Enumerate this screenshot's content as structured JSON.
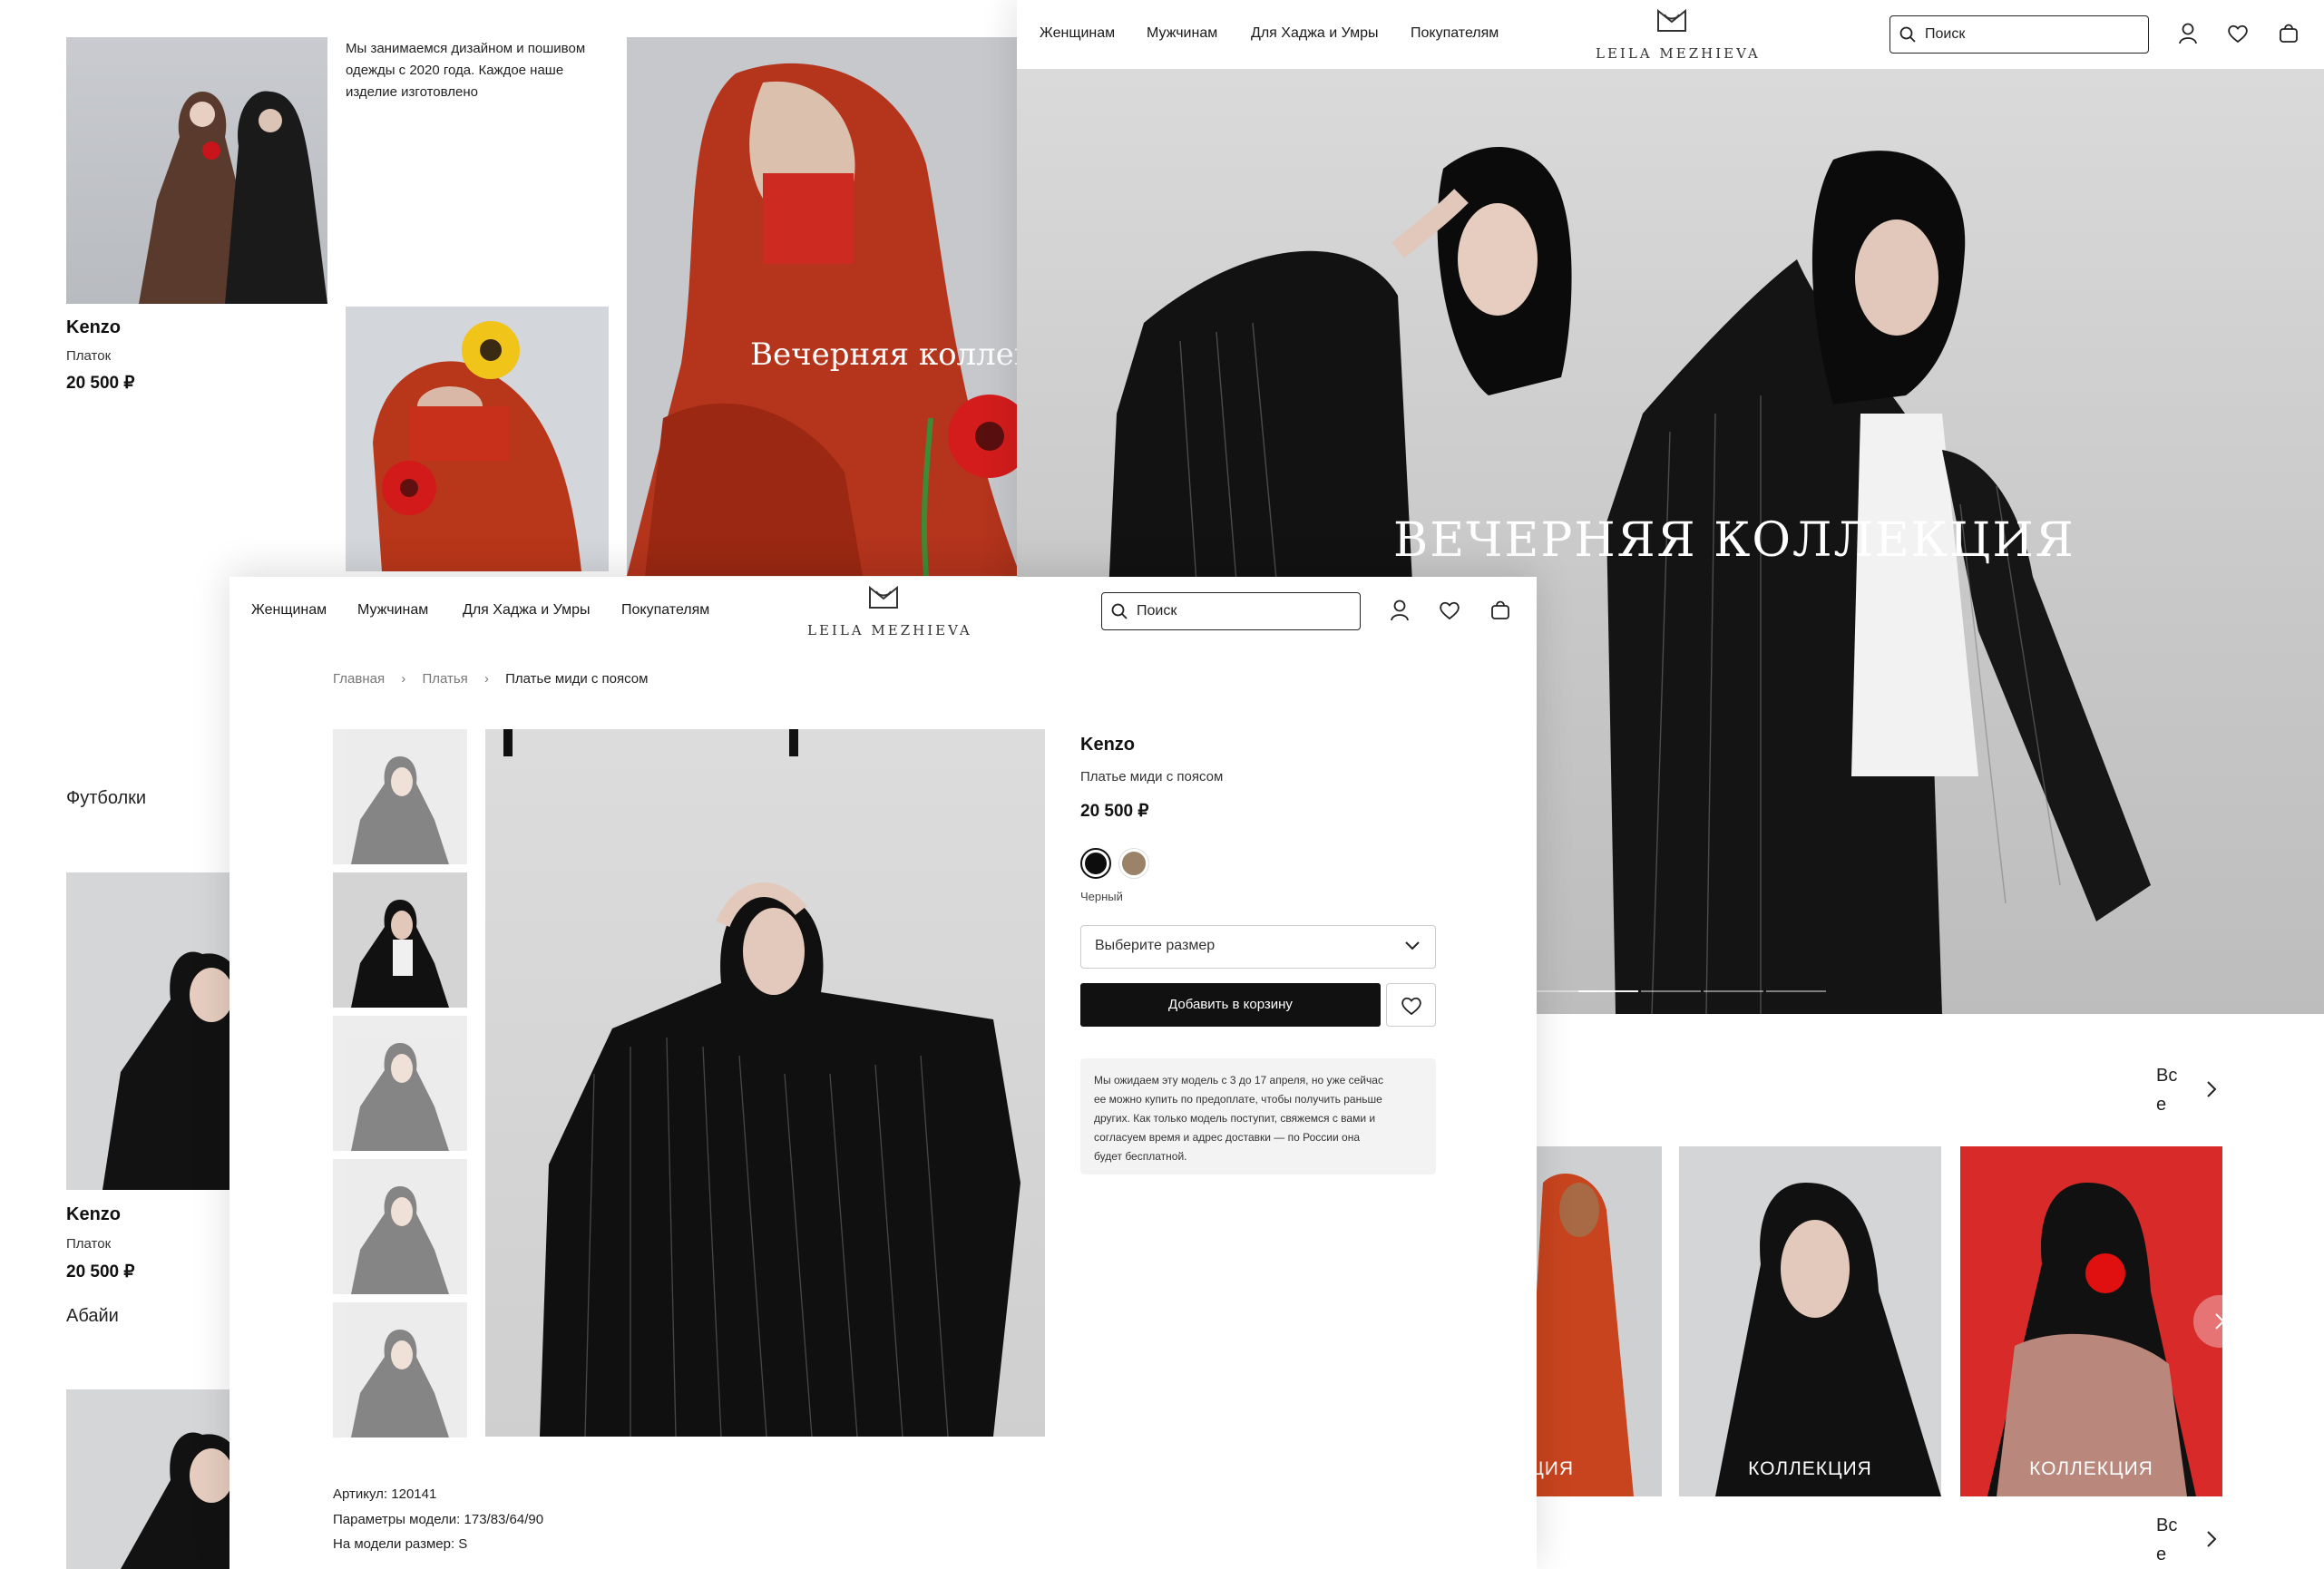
{
  "brand": "LEILA MEZHIEVA",
  "nav": [
    "Женщинам",
    "Мужчинам",
    "Для Хаджа и Умры",
    "Покупателям"
  ],
  "search_placeholder": "Поиск",
  "catalog": {
    "about_text": [
      "Мы занимаемся дизайном и пошивом",
      "одежды с 2020 года. Каждое наше",
      "изделие изготовлено"
    ],
    "card1": {
      "brand": "Kenzo",
      "type": "Платок",
      "price": "20 500 ₽"
    },
    "section_title": "Футболки",
    "card2": {
      "brand": "Kenzo",
      "type": "Платок",
      "price": "20 500 ₽"
    },
    "section2_title": "Абайи",
    "banner_caption": "Вечерняя коллекция"
  },
  "home": {
    "hero_title": "ВЕЧЕРНЯЯ КОЛЛЕКЦИЯ",
    "all_link_lines": [
      "Вс",
      "е"
    ],
    "collection_cards": [
      "КЦИЯ",
      "КОЛЛЕКЦИЯ",
      "КОЛЛЕКЦИЯ"
    ]
  },
  "product": {
    "breadcrumbs": [
      "Главная",
      "Платья",
      "Платье миди с поясом"
    ],
    "brand": "Kenzo",
    "name": "Платье миди с поясом",
    "price": "20 500 ₽",
    "selected_color": "Черный",
    "color_swatches": [
      "#0d0d0d",
      "#9a8368"
    ],
    "size_select": "Выберите размер",
    "add_to_cart": "Добавить в корзину",
    "notice": [
      "Мы ожидаем эту модель с 3 до 17 апреля, но уже сейчас",
      "ее можно купить по предоплате, чтобы получить раньше",
      "других. Как только модель поступит, свяжемся с вами и",
      "согласуем время и адрес доставки — по России она",
      "будет бесплатной."
    ],
    "article": "Артикул: 120141",
    "model_params": "Параметры модели: 173/83/64/90",
    "model_size": "На модели размер: S"
  }
}
